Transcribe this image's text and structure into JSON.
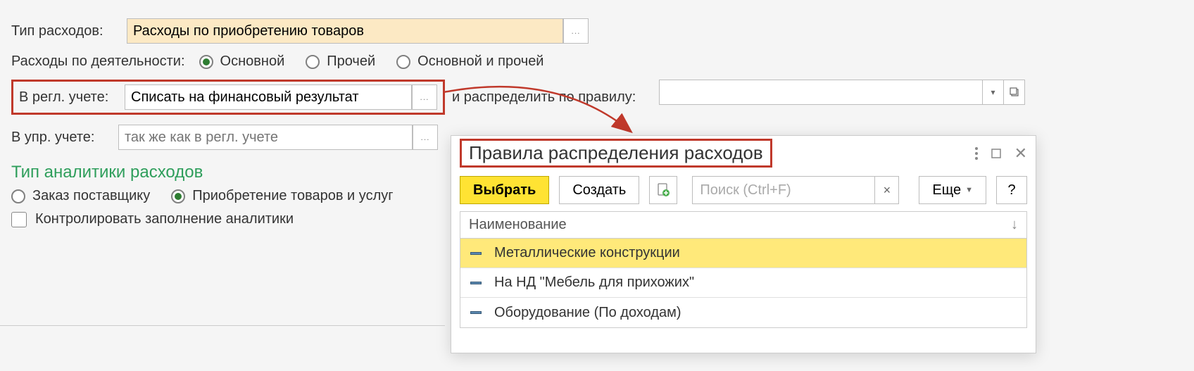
{
  "expense_type": {
    "label": "Тип расходов:",
    "value": "Расходы по приобретению товаров"
  },
  "activity": {
    "label": "Расходы по деятельности:",
    "options": {
      "main": "Основной",
      "other": "Прочей",
      "both": "Основной и прочей"
    }
  },
  "reg_account": {
    "label": "В регл. учете:",
    "value": "Списать на финансовый результат",
    "rule_label": "и распределить по правилу:"
  },
  "mgmt_account": {
    "label": "В упр. учете:",
    "placeholder": "так же как в регл. учете"
  },
  "analytics": {
    "title": "Тип аналитики расходов",
    "options": {
      "order": "Заказ поставщику",
      "purchase": "Приобретение товаров и услуг"
    },
    "control_checkbox": "Контролировать заполнение аналитики"
  },
  "popup": {
    "title": "Правила распределения расходов",
    "buttons": {
      "select": "Выбрать",
      "create": "Создать",
      "more": "Еще",
      "help": "?"
    },
    "search_placeholder": "Поиск (Ctrl+F)",
    "column_header": "Наименование",
    "rows": [
      "Металлические конструкции",
      "На НД \"Мебель для прихожих\"",
      "Оборудование (По доходам)"
    ]
  }
}
